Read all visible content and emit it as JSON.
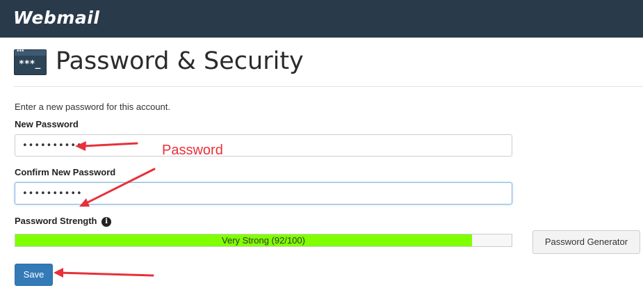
{
  "header": {
    "brand": "Webmail"
  },
  "page": {
    "icon_text": "***_",
    "title": "Password & Security"
  },
  "form": {
    "intro": "Enter a new password for this account.",
    "new_password": {
      "label": "New Password",
      "value": "••••••••••"
    },
    "confirm_password": {
      "label": "Confirm New Password",
      "value": "••••••••••"
    },
    "strength": {
      "label": "Password Strength",
      "text": "Very Strong (92/100)",
      "score": 92,
      "max": 100
    },
    "generator_label": "Password Generator",
    "save_label": "Save"
  },
  "annotation": {
    "text": "Password",
    "color": "#e8303a"
  },
  "colors": {
    "header_bg": "#293a4a",
    "meter_fill": "#80ff00",
    "save_button": "#337ab7"
  }
}
